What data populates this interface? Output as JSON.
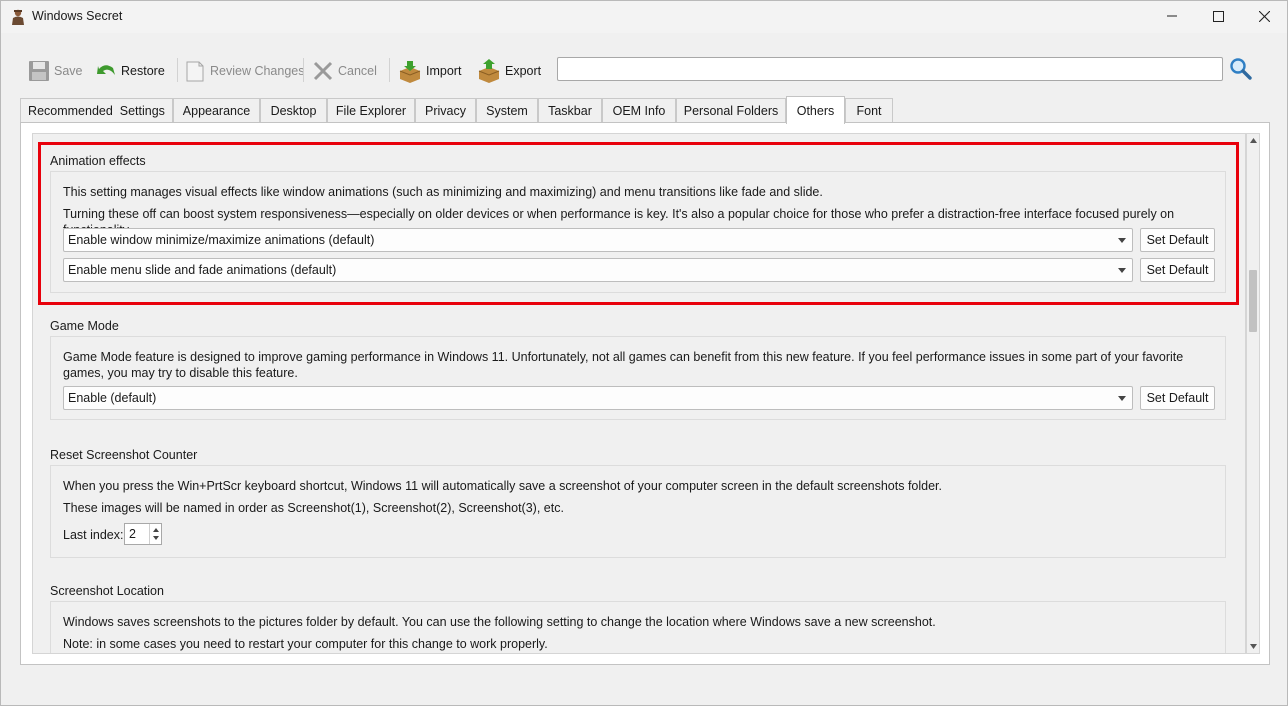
{
  "window": {
    "title": "Windows Secret"
  },
  "toolbar": {
    "save_label": "Save",
    "restore_label": "Restore",
    "review_label": "Review Changes",
    "cancel_label": "Cancel",
    "import_label": "Import",
    "export_label": "Export",
    "search_value": ""
  },
  "tabs": [
    {
      "label": "Recommended  Settings"
    },
    {
      "label": "Appearance"
    },
    {
      "label": "Desktop"
    },
    {
      "label": "File Explorer"
    },
    {
      "label": "Privacy"
    },
    {
      "label": "System"
    },
    {
      "label": "Taskbar"
    },
    {
      "label": "OEM Info"
    },
    {
      "label": "Personal Folders"
    },
    {
      "label": "Others",
      "active": true
    },
    {
      "label": "Font"
    }
  ],
  "sections": {
    "animation": {
      "title": "Animation effects",
      "desc1": "This setting manages visual effects like window animations (such as minimizing and maximizing) and menu transitions like fade and slide.",
      "desc2": "Turning these off can boost system responsiveness—especially on older devices or when performance is key. It's also a popular choice for those who prefer a distraction-free interface focused purely on functionality.",
      "combo1": "Enable window minimize/maximize animations (default)",
      "combo2": "Enable menu slide and fade animations (default)",
      "set_default": "Set Default"
    },
    "gamemode": {
      "title": "Game Mode",
      "desc": "Game Mode feature is designed to improve gaming performance in Windows 11. Unfortunately, not all games can benefit from this new feature. If you feel performance issues in some part of your favorite games, you may try to disable this feature.",
      "combo": "Enable (default)",
      "set_default": "Set Default"
    },
    "screenshot_counter": {
      "title": "Reset Screenshot Counter",
      "desc1": "When you press the Win+PrtScr keyboard shortcut, Windows 11 will automatically save a screenshot of your computer screen in the default screenshots folder.",
      "desc2": "These images will be named in order as Screenshot(1), Screenshot(2), Screenshot(3), etc.",
      "last_index_label": "Last index:",
      "last_index_value": "2"
    },
    "screenshot_location": {
      "title": "Screenshot Location",
      "desc1": "Windows saves screenshots to the pictures folder by default. You can use the following setting to change the location where Windows save a new screenshot.",
      "desc2": "Note: in some cases you need to restart your computer for this change to work properly."
    }
  },
  "colors": {
    "highlight": "#e8000b"
  }
}
